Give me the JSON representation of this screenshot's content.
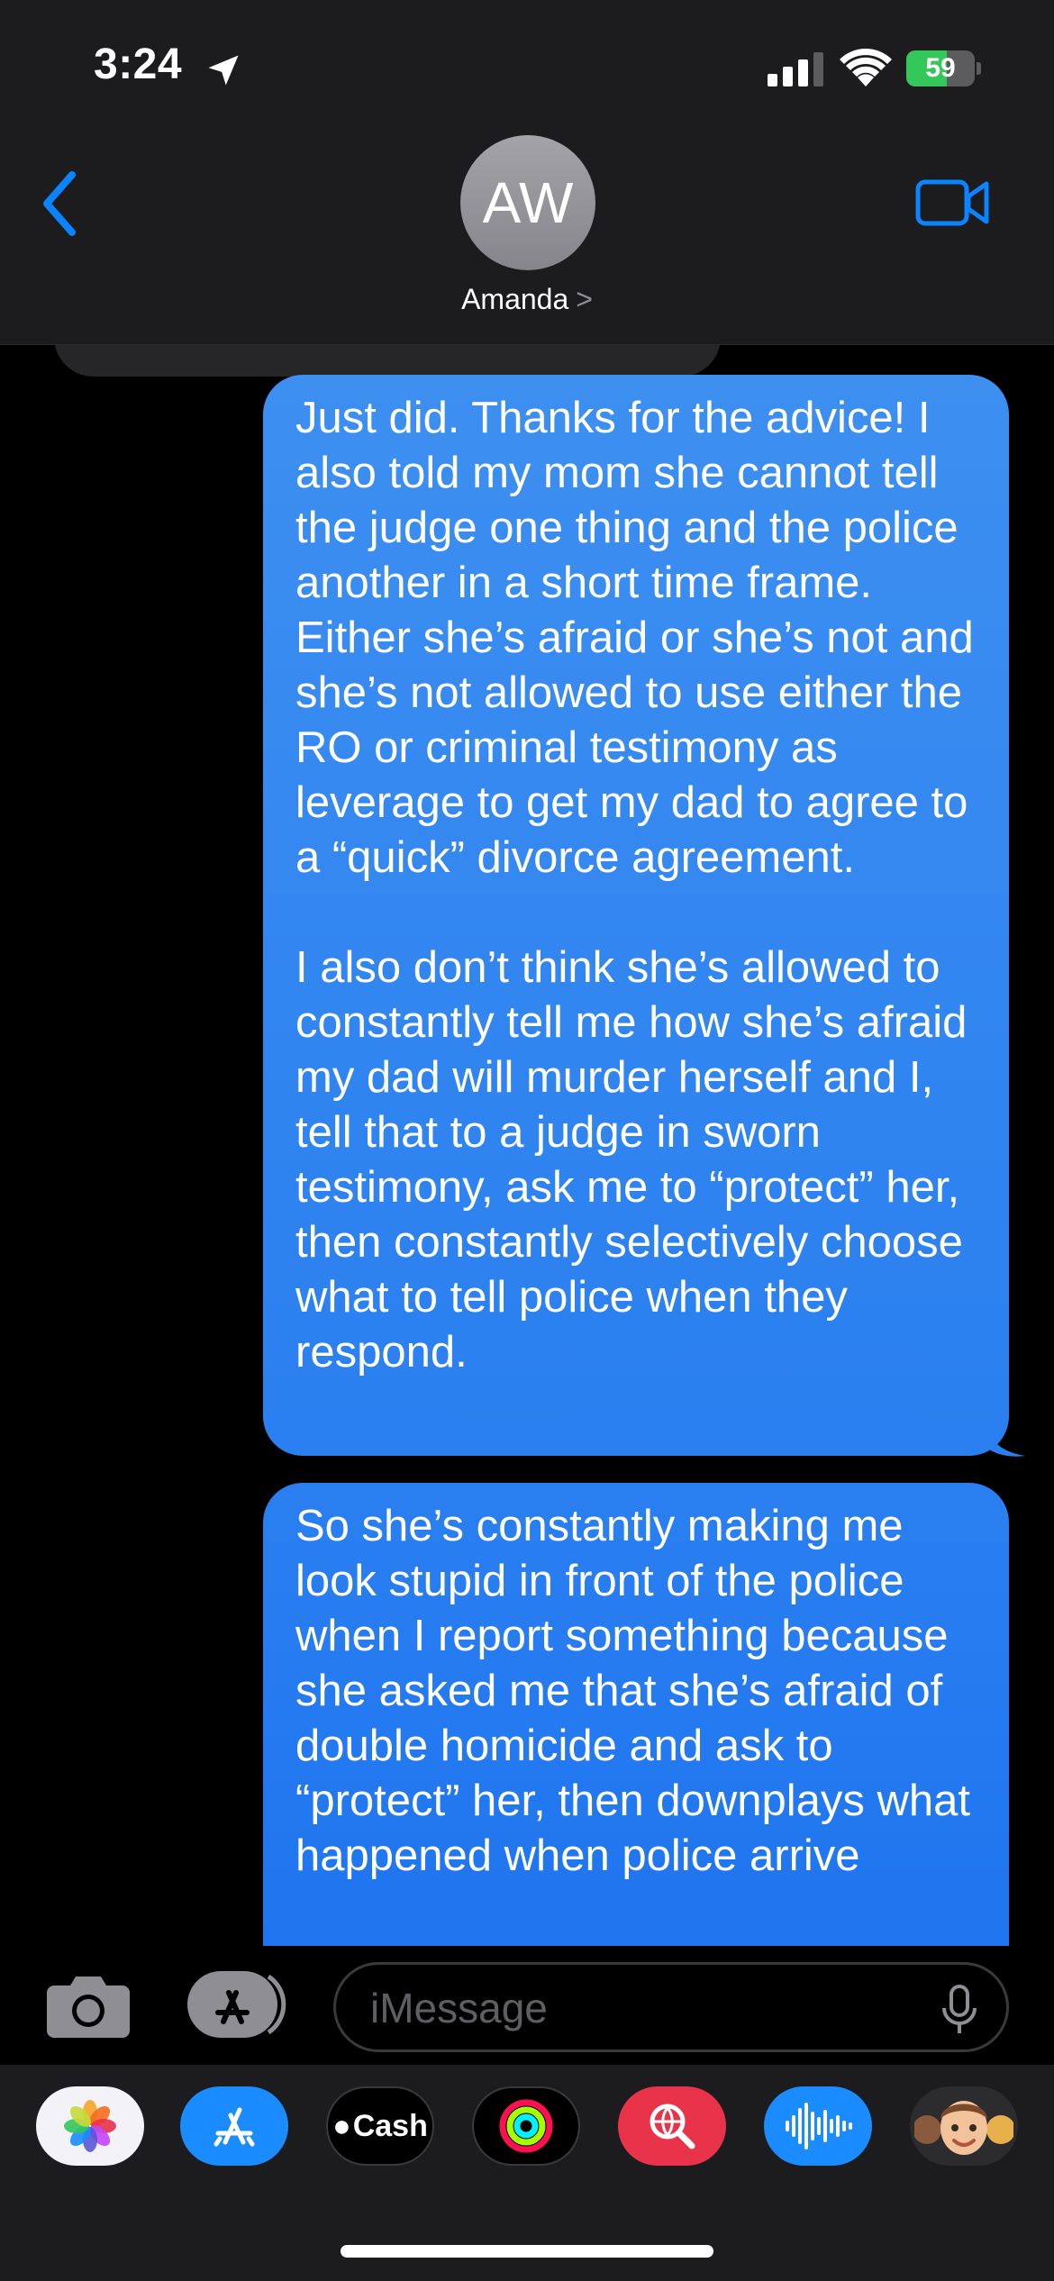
{
  "status_bar": {
    "time": "3:24",
    "battery": "59",
    "battery_level": 0.59,
    "icons": [
      "location-arrow-icon",
      "cellular-signal-icon",
      "wifi-icon",
      "battery-charging-icon"
    ]
  },
  "nav": {
    "back_icon": "chevron-left-icon",
    "avatar_initials": "AW",
    "contact_name": "Amanda",
    "contact_chevron": ">",
    "video_icon": "video-camera-icon"
  },
  "messages": [
    {
      "direction": "outgoing",
      "text": "Just did. Thanks for the advice! I also told my mom she cannot tell the judge one thing and the police another in a short time frame. Either she’s afraid or she’s not and she’s not allowed to use either the RO or criminal testimony as leverage to get my dad to agree to a “quick” divorce agreement.\n\nI also don’t think she’s allowed to constantly tell me how she’s afraid my dad will murder herself and I, tell that to a judge in sworn testimony, ask me to “protect” her, then constantly selectively choose what to tell police when they respond."
    },
    {
      "direction": "outgoing",
      "text": "So she’s constantly making me look stupid in front of the police when I report something because she asked me that she’s afraid of double homicide and ask to “protect” her, then downplays what happened when police arrive"
    }
  ],
  "input_bar": {
    "placeholder": "iMessage",
    "value": "",
    "icons": [
      "camera-icon",
      "app-store-icon",
      "microphone-icon"
    ]
  },
  "app_drawer": {
    "apps": [
      {
        "name": "photos",
        "icon": "photos-icon"
      },
      {
        "name": "app-store",
        "icon": "app-store-icon"
      },
      {
        "name": "cash",
        "icon": "apple-cash-icon",
        "label": "Cash"
      },
      {
        "name": "fitness",
        "icon": "activity-rings-icon"
      },
      {
        "name": "images",
        "icon": "image-search-icon"
      },
      {
        "name": "audio",
        "icon": "audio-waveform-icon"
      },
      {
        "name": "memoji",
        "icon": "memoji-icon"
      }
    ]
  },
  "colors": {
    "bubble_blue": "#2a7ff0",
    "header_bg": "#1c1c1e",
    "accent": "#0a84ff",
    "battery_green": "#34c759"
  }
}
